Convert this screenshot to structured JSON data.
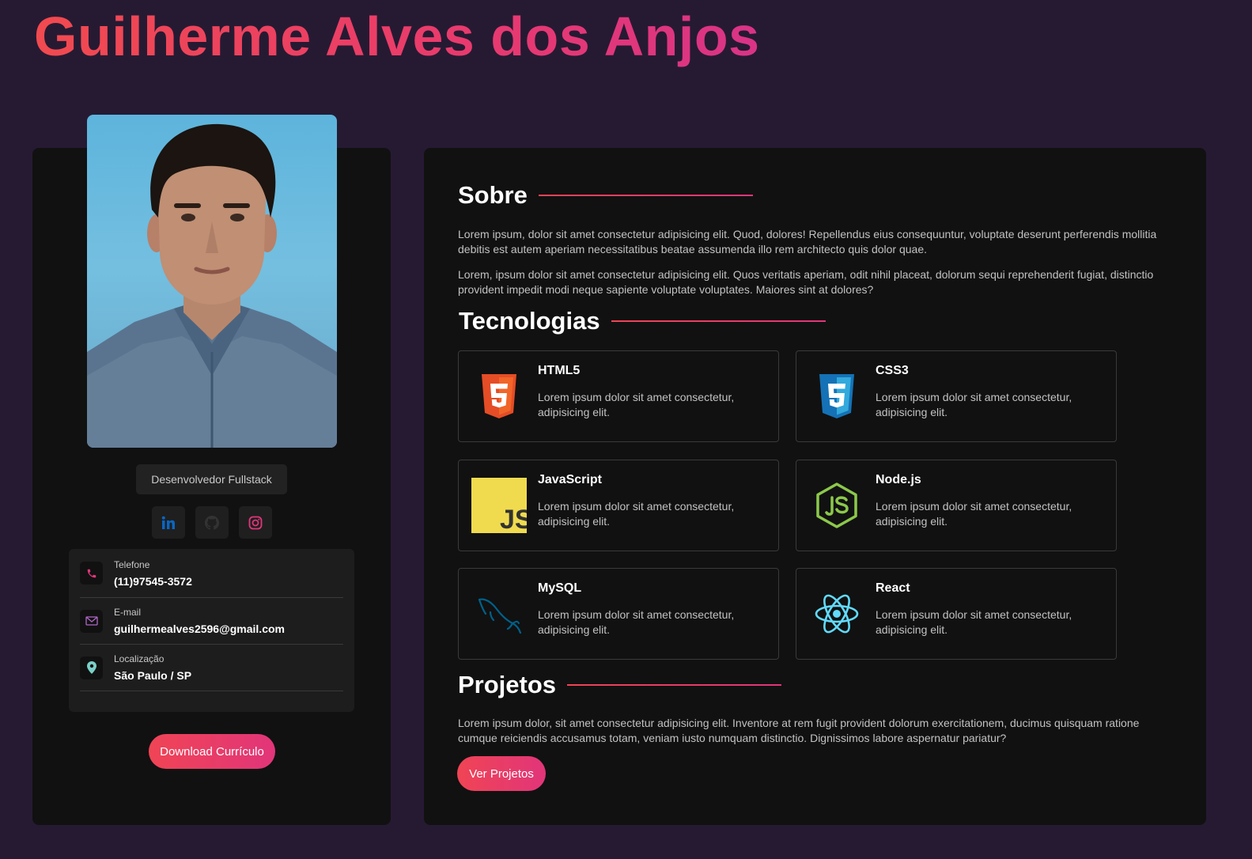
{
  "header": {
    "name": "Guilherme Alves dos Anjos"
  },
  "profile": {
    "role": "Desenvolvedor Fullstack",
    "social": [
      {
        "icon": "linkedin-icon",
        "color": "#0a66c2"
      },
      {
        "icon": "github-icon",
        "color": "#333333"
      },
      {
        "icon": "instagram-icon",
        "color": "#e1357a"
      }
    ],
    "contacts": [
      {
        "label": "Telefone",
        "value": "(11)97545-3572",
        "icon": "phone-icon"
      },
      {
        "label": "E-mail",
        "value": "guilhermealves2596@gmail.com",
        "icon": "mail-icon"
      },
      {
        "label": "Localização",
        "value": "São Paulo / SP",
        "icon": "location-icon"
      }
    ],
    "download_label": "Download Currículo"
  },
  "about": {
    "title": "Sobre",
    "paragraphs": [
      "Lorem ipsum, dolor sit amet consectetur adipisicing elit. Quod, dolores! Repellendus eius consequuntur, voluptate deserunt perferendis mollitia debitis est autem aperiam necessitatibus beatae assumenda illo rem architecto quis dolor quae.",
      "Lorem, ipsum dolor sit amet consectetur adipisicing elit. Quos veritatis aperiam, odit nihil placeat, dolorum sequi reprehenderit fugiat, distinctio provident impedit modi neque sapiente voluptate voluptates. Maiores sint at dolores?"
    ]
  },
  "technologies": {
    "title": "Tecnologias",
    "items": [
      {
        "name": "HTML5",
        "description": "Lorem ipsum dolor sit amet consectetur, adipisicing elit.",
        "icon": "html5-icon",
        "color": "#e44d26"
      },
      {
        "name": "CSS3",
        "description": "Lorem ipsum dolor sit amet consectetur, adipisicing elit.",
        "icon": "css3-icon",
        "color": "#1572b6"
      },
      {
        "name": "JavaScript",
        "description": "Lorem ipsum dolor sit amet consectetur, adipisicing elit.",
        "icon": "javascript-icon",
        "color": "#f0db4f",
        "badge": "JS"
      },
      {
        "name": "Node.js",
        "description": "Lorem ipsum dolor sit amet consectetur, adipisicing elit.",
        "icon": "nodejs-icon",
        "color": "#8cc84b"
      },
      {
        "name": "MySQL",
        "description": "Lorem ipsum dolor sit amet consectetur, adipisicing elit.",
        "icon": "mysql-icon",
        "color": "#00618a"
      },
      {
        "name": "React",
        "description": "Lorem ipsum dolor sit amet consectetur, adipisicing elit.",
        "icon": "react-icon",
        "color": "#61dafb"
      }
    ]
  },
  "projects": {
    "title": "Projetos",
    "description": "Lorem ipsum dolor, sit amet consectetur adipisicing elit. Inventore at rem fugit provident dolorum exercitationem, ducimus quisquam ratione cumque reiciendis accusamus totam, veniam iusto numquam distinctio. Dignissimos labore aspernatur pariatur?",
    "button_label": "Ver Projetos"
  },
  "colors": {
    "background": "#261a33",
    "card": "#111111",
    "accent_start": "#f04455",
    "accent_end": "#e1357a"
  }
}
